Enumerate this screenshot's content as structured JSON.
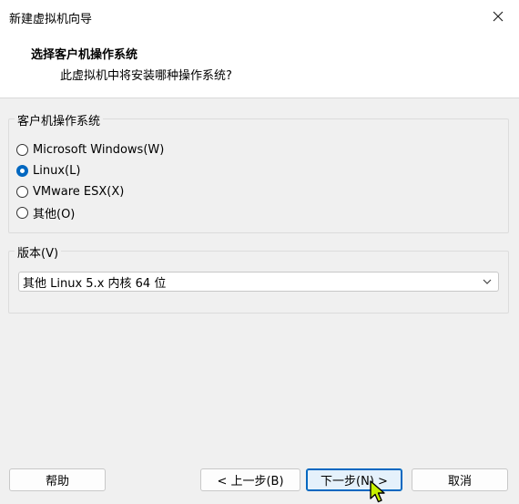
{
  "window": {
    "title": "新建虚拟机向导"
  },
  "header": {
    "title": "选择客户机操作系统",
    "subtitle": "此虚拟机中将安装哪种操作系统?"
  },
  "os_group": {
    "legend": "客户机操作系统",
    "options": [
      {
        "label": "Microsoft Windows(W)",
        "checked": false
      },
      {
        "label": "Linux(L)",
        "checked": true
      },
      {
        "label": "VMware ESX(X)",
        "checked": false
      },
      {
        "label": "其他(O)",
        "checked": false
      }
    ]
  },
  "version_group": {
    "legend": "版本(V)",
    "selected": "其他 Linux 5.x 内核 64 位"
  },
  "buttons": {
    "help": "帮助",
    "back": "< 上一步(B)",
    "next": "下一步(N) >",
    "cancel": "取消"
  },
  "colors": {
    "accent": "#0067c0",
    "cursor": "#c8f000"
  }
}
